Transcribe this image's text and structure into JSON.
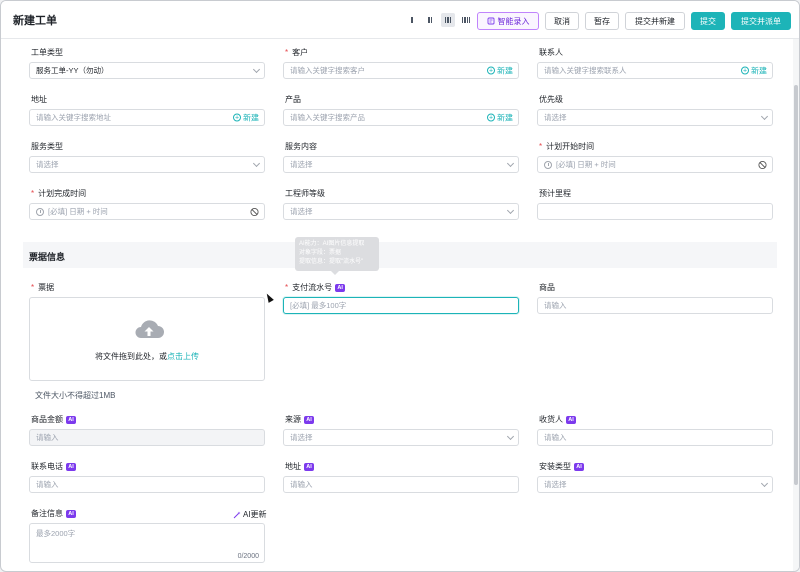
{
  "header": {
    "title": "新建工单",
    "layout_icons": [
      "single-column-icon",
      "two-column-icon",
      "three-column-icon",
      "four-column-icon"
    ],
    "buttons": {
      "ai_entry": "智能录入",
      "cancel": "取消",
      "save_draft": "暂存",
      "submit_and_new": "提交并新建",
      "submit": "提交",
      "submit_and_dispatch": "提交并派单"
    }
  },
  "form": {
    "ticket_type": {
      "label": "工单类型",
      "value": "服务工单-YY（勿动）"
    },
    "customer": {
      "label": "客户",
      "placeholder": "请输入关键字搜索客户",
      "action": "新建"
    },
    "contact": {
      "label": "联系人",
      "placeholder": "请输入关键字搜索联系人",
      "action": "新建"
    },
    "address": {
      "label": "地址",
      "placeholder": "请输入关键字搜索地址",
      "action": "新建"
    },
    "product": {
      "label": "产品",
      "placeholder": "请输入关键字搜索产品",
      "action": "新建"
    },
    "priority": {
      "label": "优先级",
      "placeholder": "请选择"
    },
    "service_type": {
      "label": "服务类型",
      "placeholder": "请选择"
    },
    "service_content": {
      "label": "服务内容",
      "placeholder": "请选择"
    },
    "plan_start": {
      "label": "计划开始时间",
      "placeholder": "[必填] 日期 + 时间"
    },
    "plan_end": {
      "label": "计划完成时间",
      "placeholder": "[必填] 日期 + 时间"
    },
    "engineer_level": {
      "label": "工程师等级",
      "placeholder": "请选择"
    },
    "est_mileage": {
      "label": "预计里程",
      "placeholder": ""
    }
  },
  "invoice": {
    "section_title": "票据信息",
    "ticket": {
      "label": "票据",
      "upload_text": "将文件拖到此处，或",
      "upload_link": "点击上传",
      "hint": "文件大小不得超过1MB"
    },
    "payment_no": {
      "label": "支付流水号",
      "badge": "AI",
      "placeholder": "[必填] 最多100字"
    },
    "tooltip": [
      "AI能力：AI图片信息提取",
      "对象字段：票据",
      "提取信息：提取\"流水号\""
    ],
    "goods": {
      "label": "商品",
      "placeholder": "请输入"
    },
    "goods_amount": {
      "label": "商品金额",
      "badge": "AI",
      "placeholder": "请输入"
    },
    "source": {
      "label": "来源",
      "badge": "AI",
      "placeholder": "请选择"
    },
    "receiver": {
      "label": "收货人",
      "badge": "AI",
      "placeholder": "请输入"
    },
    "phone": {
      "label": "联系电话",
      "badge": "AI",
      "placeholder": "请输入"
    },
    "addr2": {
      "label": "地址",
      "badge": "AI",
      "placeholder": "请输入"
    },
    "install_type": {
      "label": "安装类型",
      "badge": "AI",
      "placeholder": "请选择"
    },
    "remark": {
      "label": "备注信息",
      "badge": "AI",
      "placeholder": "最多2000字",
      "counter": "0/2000",
      "ai_update": "AI更新"
    }
  },
  "colors": {
    "accent": "#1db4b8",
    "ai_purple": "#7c3aed",
    "required": "#e5484d"
  }
}
